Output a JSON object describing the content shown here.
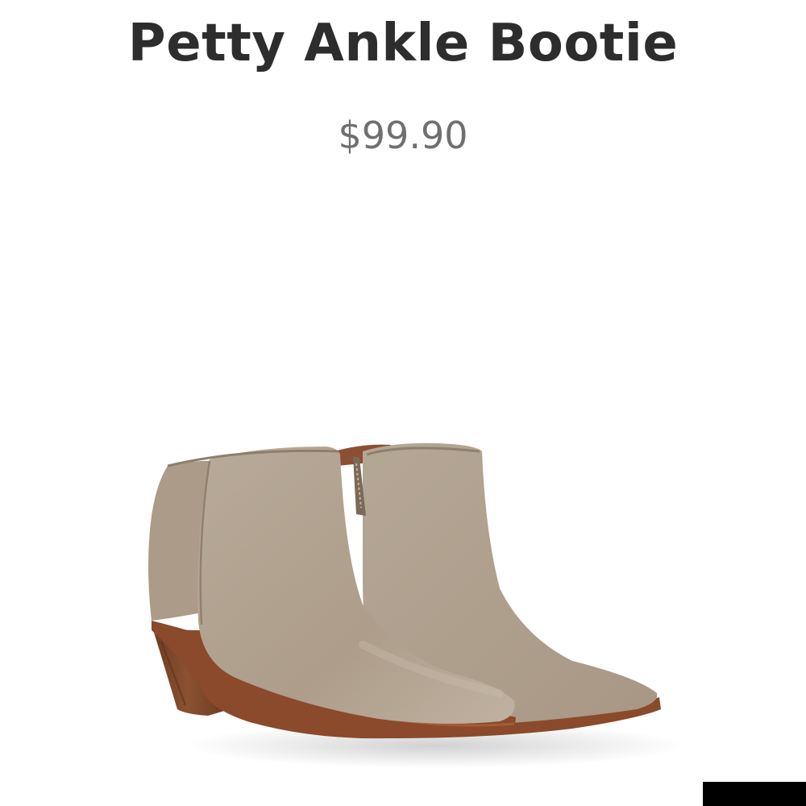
{
  "product": {
    "title": "Petty Ankle Bootie",
    "price": "$99.90",
    "image_subject": "pair of taupe suede ankle booties",
    "colors": {
      "suede": "#b3a595",
      "sole": "#8a4a2b",
      "heel": "#7a4426"
    }
  },
  "corner_bar": {
    "color": "#000000"
  }
}
